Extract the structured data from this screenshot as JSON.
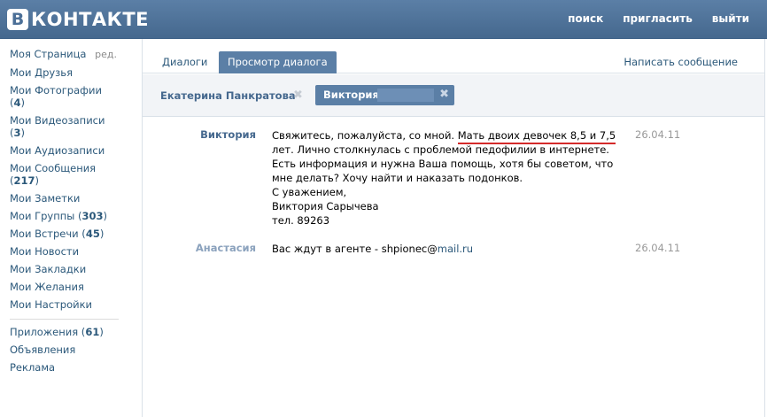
{
  "header": {
    "logo_letter": "B",
    "logo_text": "КОНТАКТЕ",
    "nav": [
      "поиск",
      "пригласить",
      "выйти"
    ]
  },
  "sidebar": {
    "my_page": "Моя Страница",
    "edit": "ред.",
    "items": [
      {
        "label": "Мои Друзья",
        "count": ""
      },
      {
        "label": "Мои Фотографии",
        "count": "4"
      },
      {
        "label": "Мои Видеозаписи",
        "count": "3"
      },
      {
        "label": "Мои Аудиозаписи",
        "count": ""
      },
      {
        "label": "Мои Сообщения",
        "count": "217"
      },
      {
        "label": "Мои Заметки",
        "count": ""
      },
      {
        "label": "Мои Группы",
        "count": "303"
      },
      {
        "label": "Мои Встречи",
        "count": "45"
      },
      {
        "label": "Мои Новости",
        "count": ""
      },
      {
        "label": "Мои Закладки",
        "count": ""
      },
      {
        "label": "Мои Желания",
        "count": ""
      },
      {
        "label": "Мои Настройки",
        "count": ""
      }
    ],
    "extra": [
      {
        "label": "Приложения",
        "count": "61"
      },
      {
        "label": "Объявления",
        "count": ""
      },
      {
        "label": "Реклама",
        "count": ""
      }
    ]
  },
  "tabs": {
    "dialogs": "Диалоги",
    "view_dialog": "Просмотр диалога",
    "write_message": "Написать сообщение"
  },
  "peers": {
    "peer1": "Екатерина Панкратова",
    "peer2": "Виктория",
    "close": "✖"
  },
  "messages": [
    {
      "author": "Виктория",
      "author_color": "#45688e",
      "date": "26.04.11",
      "line1_start": "Свяжитесь, пожалуйста, со мной. ",
      "line1_underlined": "Мать двоих девочек 8,5 и 7,5",
      "rest": [
        "лет. Лично столкнулась с проблемой педофилии в интернете.",
        "Есть информация и нужна Ваша помощь, хотя бы советом, что",
        "мне делать? Хочу найти и наказать подонков.",
        "С уважением,",
        "Виктория Сарычева",
        "тел. 89263"
      ]
    },
    {
      "author": "Анастасия",
      "author_color": "#8ba2bd",
      "date": "26.04.11",
      "text_start": "Вас ждут в агенте - shpionec@",
      "link": "mail.ru"
    }
  ]
}
